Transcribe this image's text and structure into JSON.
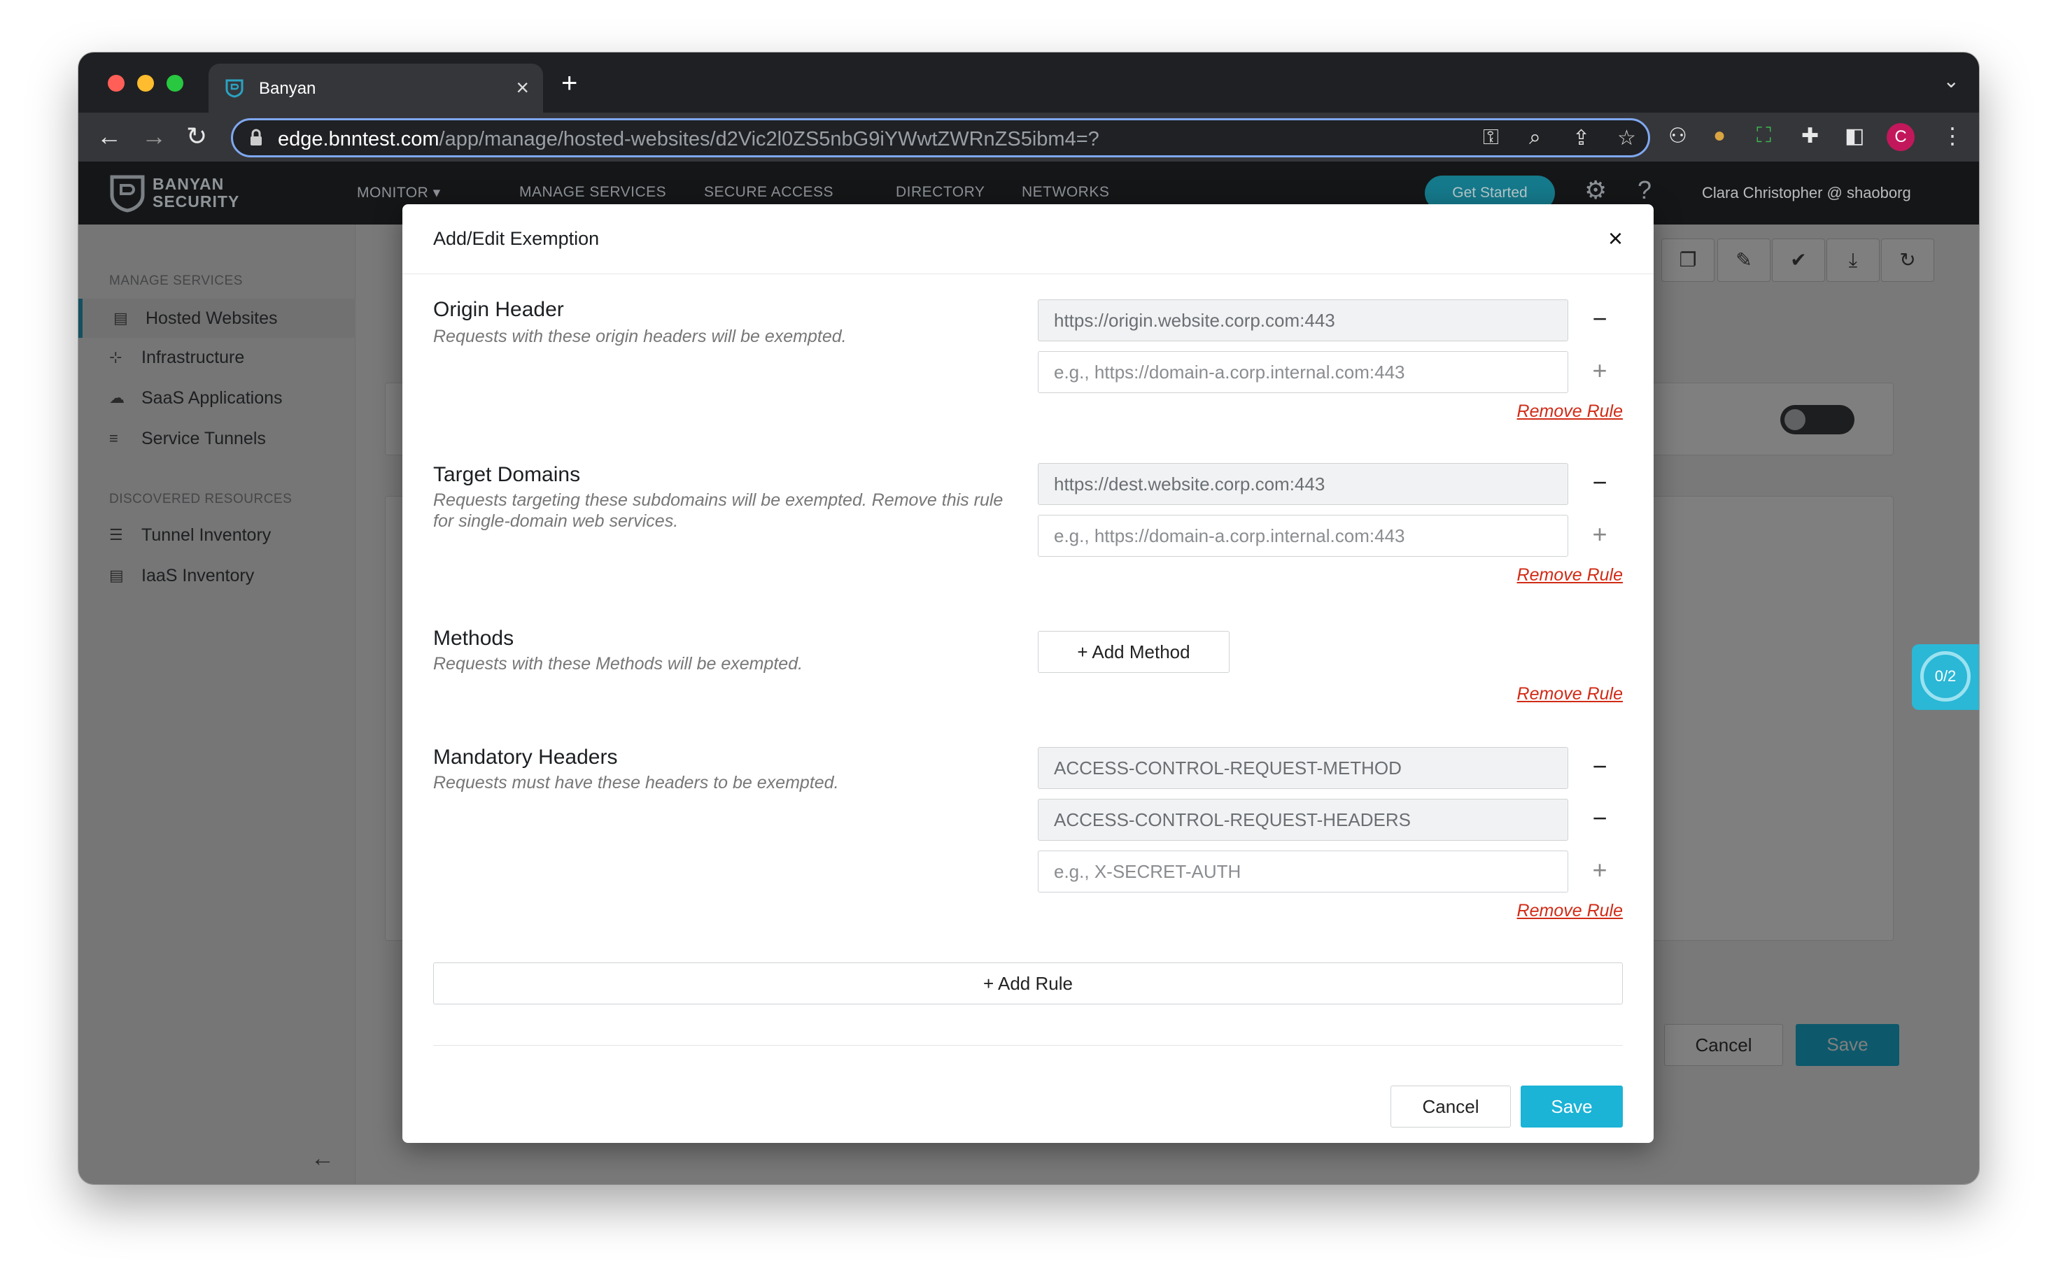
{
  "browser": {
    "tab_title": "Banyan",
    "url_domain": "edge.bnntest.com",
    "url_path": "/app/manage/hosted-websites/d2Vic2l0ZS5nbG9iYWwtZWRnZS5ibm4=?",
    "avatar_letter": "C"
  },
  "app": {
    "brand_line1": "BANYAN",
    "brand_line2": "SECURITY",
    "nav": [
      "MONITOR",
      "MANAGE SERVICES",
      "SECURE ACCESS",
      "DIRECTORY",
      "NETWORKS"
    ],
    "get_started": "Get Started",
    "user": "Clara Christopher @ shaoborg",
    "accent_color": "#1bb3d6"
  },
  "sidebar": {
    "section1": "MANAGE SERVICES",
    "items1": [
      {
        "label": "Hosted Websites",
        "icon": "list-icon",
        "active": true
      },
      {
        "label": "Infrastructure",
        "icon": "network-icon",
        "active": false
      },
      {
        "label": "SaaS Applications",
        "icon": "cloud-icon",
        "active": false
      },
      {
        "label": "Service Tunnels",
        "icon": "menu-icon",
        "active": false
      }
    ],
    "section2": "DISCOVERED RESOURCES",
    "items2": [
      {
        "label": "Tunnel Inventory",
        "icon": "list-icon"
      },
      {
        "label": "IaaS Inventory",
        "icon": "list-icon"
      }
    ]
  },
  "background": {
    "cancel": "Cancel",
    "save": "Save",
    "badge": "0/2"
  },
  "modal": {
    "title": "Add/Edit Exemption",
    "remove_rule": "Remove Rule",
    "rules": {
      "origin": {
        "label": "Origin Header",
        "desc": "Requests with these origin headers will be exempted.",
        "value1": "https://origin.website.corp.com:443",
        "placeholder": "e.g., https://domain-a.corp.internal.com:443"
      },
      "target": {
        "label": "Target Domains",
        "desc": "Requests targeting these subdomains will be exempted. Remove this rule for single-domain web services.",
        "value1": "https://dest.website.corp.com:443",
        "placeholder": "e.g., https://domain-a.corp.internal.com:443"
      },
      "methods": {
        "label": "Methods",
        "desc": "Requests with these Methods will be exempted.",
        "add_method": "Add Method"
      },
      "headers": {
        "label": "Mandatory Headers",
        "desc": "Requests must have these headers to be exempted.",
        "value1": "ACCESS-CONTROL-REQUEST-METHOD",
        "value2": "ACCESS-CONTROL-REQUEST-HEADERS",
        "placeholder": "e.g., X-SECRET-AUTH"
      }
    },
    "add_rule": "Add Rule",
    "cancel": "Cancel",
    "save": "Save"
  }
}
